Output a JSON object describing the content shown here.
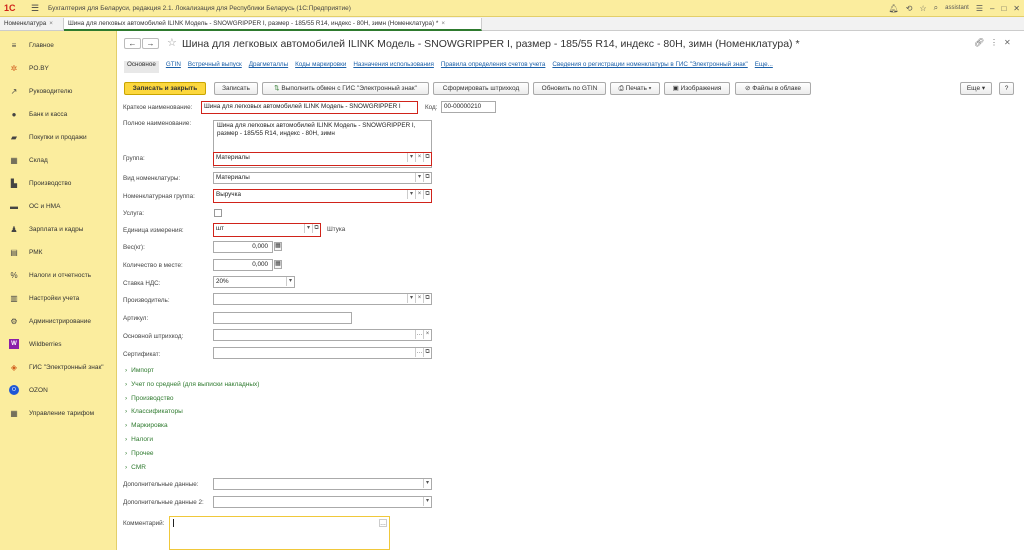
{
  "app": {
    "title": "Бухгалтерия для Беларуси, редакция 2.1. Локализация для Республики Беларусь  (1С:Предприятие)",
    "user": "assistant"
  },
  "tabs": [
    {
      "label": "Номенклатура"
    },
    {
      "label": "Шина для легковых автомобилей ILINK  Модель - SNOWGRIPPER I, размер - 185/55 R14, индекс - 80H, зимн (Номенклатура) *"
    }
  ],
  "sidebar": {
    "items": [
      {
        "label": "Главное",
        "icon": "menu-icon"
      },
      {
        "label": "PO.BY",
        "icon": "asterisk-icon"
      },
      {
        "label": "Руководителю",
        "icon": "trend-icon"
      },
      {
        "label": "Банк и касса",
        "icon": "bank-icon"
      },
      {
        "label": "Покупки и продажи",
        "icon": "cart-icon"
      },
      {
        "label": "Склад",
        "icon": "warehouse-icon"
      },
      {
        "label": "Производство",
        "icon": "factory-icon"
      },
      {
        "label": "ОС и НМА",
        "icon": "truck-icon"
      },
      {
        "label": "Зарплата и кадры",
        "icon": "people-icon"
      },
      {
        "label": "РМК",
        "icon": "register-icon"
      },
      {
        "label": "Налоги и отчетность",
        "icon": "percent-icon"
      },
      {
        "label": "Настройки учета",
        "icon": "settings-icon"
      },
      {
        "label": "Администрирование",
        "icon": "gear-icon"
      },
      {
        "label": "Wildberries",
        "icon": "wildberries-icon"
      },
      {
        "label": "ГИС \"Электронный знак\"",
        "icon": "diamond-icon"
      },
      {
        "label": "OZON",
        "icon": "ozon-icon"
      },
      {
        "label": "Управление тарифом",
        "icon": "grid-icon"
      }
    ]
  },
  "form": {
    "title": "Шина для легковых автомобилей ILINK  Модель - SNOWGRIPPER I, размер - 185/55 R14, индекс - 80H, зимн (Номенклатура) *",
    "links": [
      "Основное",
      "GTIN",
      "Встречный выпуск",
      "Драгметаллы",
      "Коды маркировки",
      "Назначения использования",
      "Правила определения счетов учета",
      "Сведения о регистрации номенклатуры в ГИС \"Электронный знак\"",
      "Еще..."
    ],
    "toolbar": {
      "save_close": "Записать и закрыть",
      "save": "Записать",
      "exchange": "Выполнить обмен с ГИС \"Электронный знак\"",
      "barcode": "Сформировать штрихкод",
      "gtin": "Обновить по GTIN",
      "print": "Печать",
      "images": "Изображения",
      "cloud": "Файлы в облаке",
      "more": "Еще",
      "help": "?"
    },
    "short_name_label": "Краткое наименование:",
    "short_name": "Шина для легковых автомобилей ILINK  Модель - SNOWGRIPPER I",
    "code_label": "Код:",
    "code": "00-00000210",
    "full_name_label": "Полное наименование:",
    "full_name": "Шина для легковых автомобилей ILINK  Модель - SNOWGRIPPER I, размер - 185/55 R14, индекс - 80H, зимн",
    "group_label": "Группа:",
    "group": "Материалы",
    "kind_label": "Вид номенклатуры:",
    "kind": "Материалы",
    "nomgroup_label": "Номенклатурная группа:",
    "nomgroup": "Выручка",
    "service_label": "Услуга:",
    "unit_label": "Единица измерения:",
    "unit": "шт",
    "unit_name": "Штука",
    "weight_label": "Вес(кг):",
    "weight": "0,000",
    "qty_label": "Количество в месте:",
    "qty": "0,000",
    "vat_label": "Ставка НДС:",
    "vat": "20%",
    "maker_label": "Производитель:",
    "maker": "",
    "article_label": "Артикул:",
    "article": "",
    "barcode_label": "Основной штрихкод:",
    "barcode": "",
    "cert_label": "Сертификат:",
    "cert": "",
    "groups": [
      "Импорт",
      "Учет по средней (для выписки накладных)",
      "Производство",
      "Классификаторы",
      "Маркировка",
      "Налоги",
      "Прочее",
      "CMR"
    ],
    "extra1_label": "Дополнительные данные:",
    "extra2_label": "Дополнительные данные 2:",
    "comment_label": "Комментарий:"
  }
}
